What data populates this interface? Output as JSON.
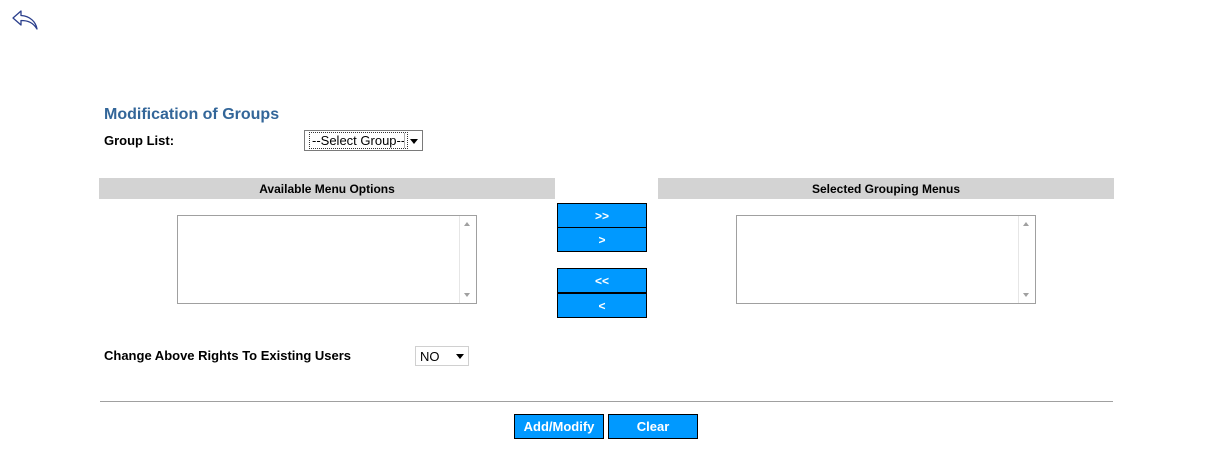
{
  "nav": {
    "back_icon": "back-arrow-icon"
  },
  "form": {
    "title": "Modification of Groups",
    "group_list_label": "Group List:",
    "group_select_value": "--Select Group--",
    "available_header": "Available Menu Options",
    "selected_header": "Selected Grouping Menus",
    "available_items": [],
    "selected_items": [],
    "buttons": {
      "add_all": ">>",
      "add": ">",
      "remove_all": "<<",
      "remove": "<"
    },
    "rights_label": "Change Above Rights To Existing Users",
    "rights_value": "NO",
    "add_modify_label": "Add/Modify",
    "clear_label": "Clear"
  },
  "colors": {
    "accent": "#0099ff",
    "title": "#336699",
    "header_bg": "#d3d3d3"
  }
}
